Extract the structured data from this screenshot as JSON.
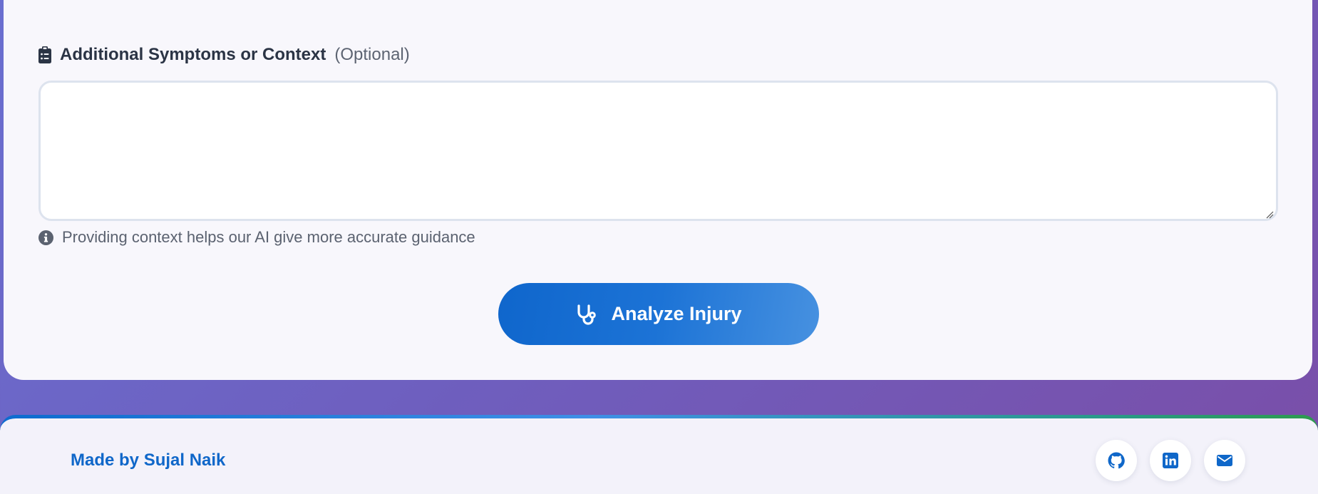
{
  "form": {
    "symptoms_label": "Additional Symptoms or Context",
    "optional_label": "(Optional)",
    "symptoms_value": "",
    "symptoms_placeholder": "",
    "help_text": "Providing context helps our AI give more accurate guidance",
    "analyze_label": "Analyze Injury"
  },
  "footer": {
    "credit": "Made by Sujal Naik",
    "links": [
      "github-icon",
      "linkedin-icon",
      "email-icon"
    ]
  },
  "colors": {
    "accent": "#0f66cc",
    "text_dark": "#2b3445",
    "muted": "#5b6270"
  }
}
